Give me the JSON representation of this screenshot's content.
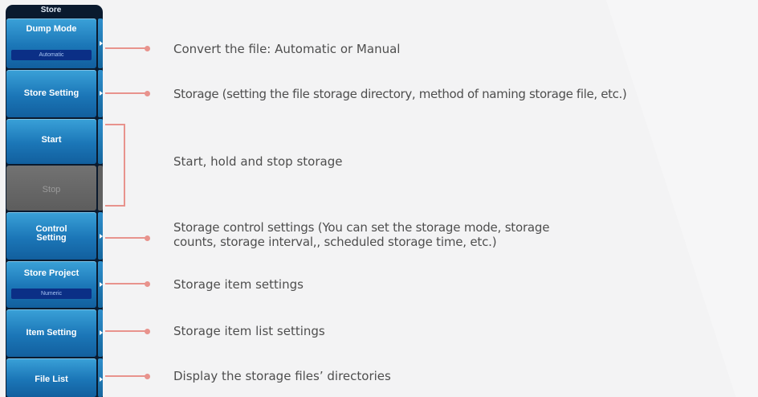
{
  "panel": {
    "title": "Store",
    "dump_mode": {
      "label": "Dump Mode",
      "value": "Automatic"
    },
    "store_setting": {
      "label": "Store Setting"
    },
    "start": {
      "label": "Start"
    },
    "stop": {
      "label": "Stop"
    },
    "control_setting": {
      "label_line1": "Control",
      "label_line2": "Setting"
    },
    "store_project": {
      "label": "Store Project",
      "value": "Numeric"
    },
    "item_setting": {
      "label": "Item Setting"
    },
    "file_list": {
      "label": "File List"
    }
  },
  "annotations": {
    "dump_mode": "Convert the file: Automatic or Manual",
    "store_setting": "Storage (setting the file storage directory, method of naming storage file, etc.)",
    "start_stop": "Start, hold and stop storage",
    "control_setting_line1": "Storage control settings (You can set the storage mode, storage",
    "control_setting_line2": "counts, storage interval,, scheduled storage time, etc.)",
    "store_project": "Storage item settings",
    "item_setting": "Storage item list settings",
    "file_list": "Display the storage files’ directories"
  },
  "colors": {
    "panel_bg": "#0a1a2e",
    "button_blue": "#1b76b7",
    "value_box": "#0b2f86",
    "disabled": "#666666",
    "connector": "#e8938d",
    "text": "#4e4e4e"
  }
}
